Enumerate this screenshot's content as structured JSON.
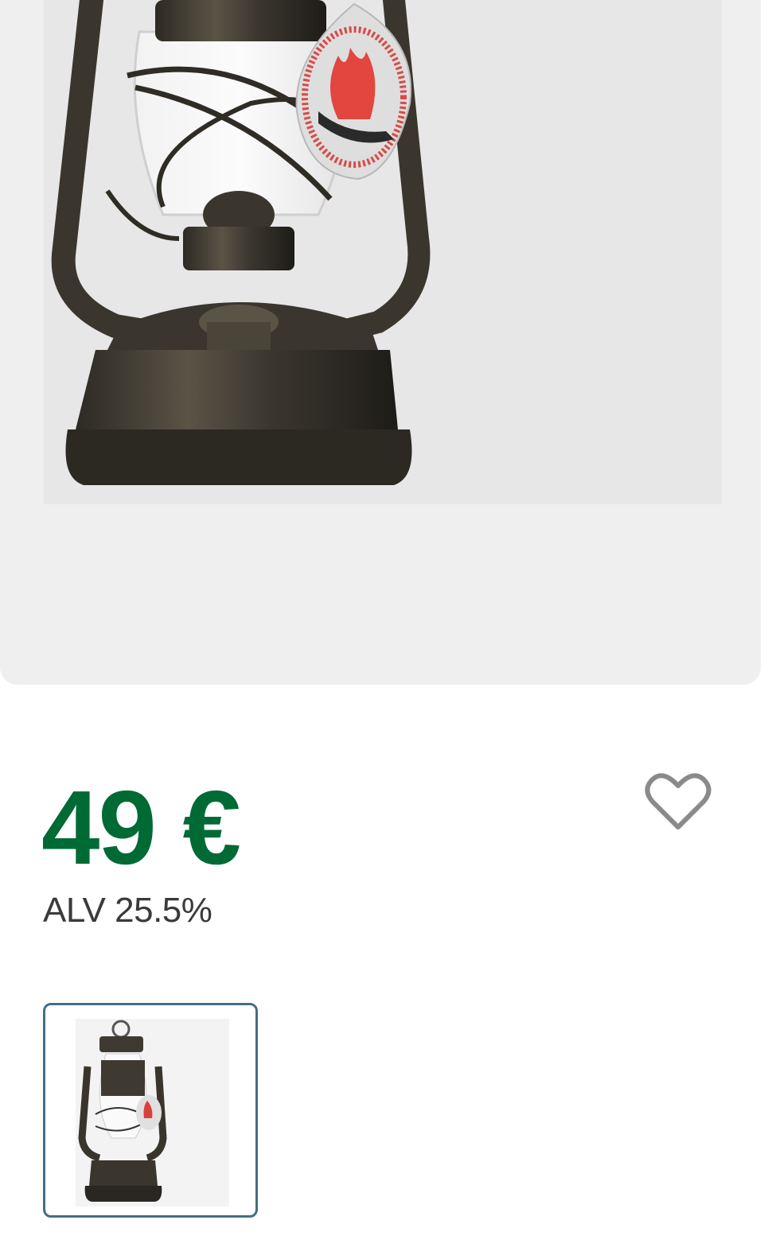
{
  "product": {
    "price": "49 €",
    "vat": "ALV 25.5%",
    "image_alt": "lantern-product-photo"
  },
  "favorite": {
    "icon": "heart-outline-icon"
  },
  "thumbnails": [
    {
      "icon": "lantern-thumbnail",
      "selected": true
    }
  ],
  "colors": {
    "price": "#006a35",
    "thumb_border": "#456d87",
    "gallery_bg": "#efefef"
  }
}
